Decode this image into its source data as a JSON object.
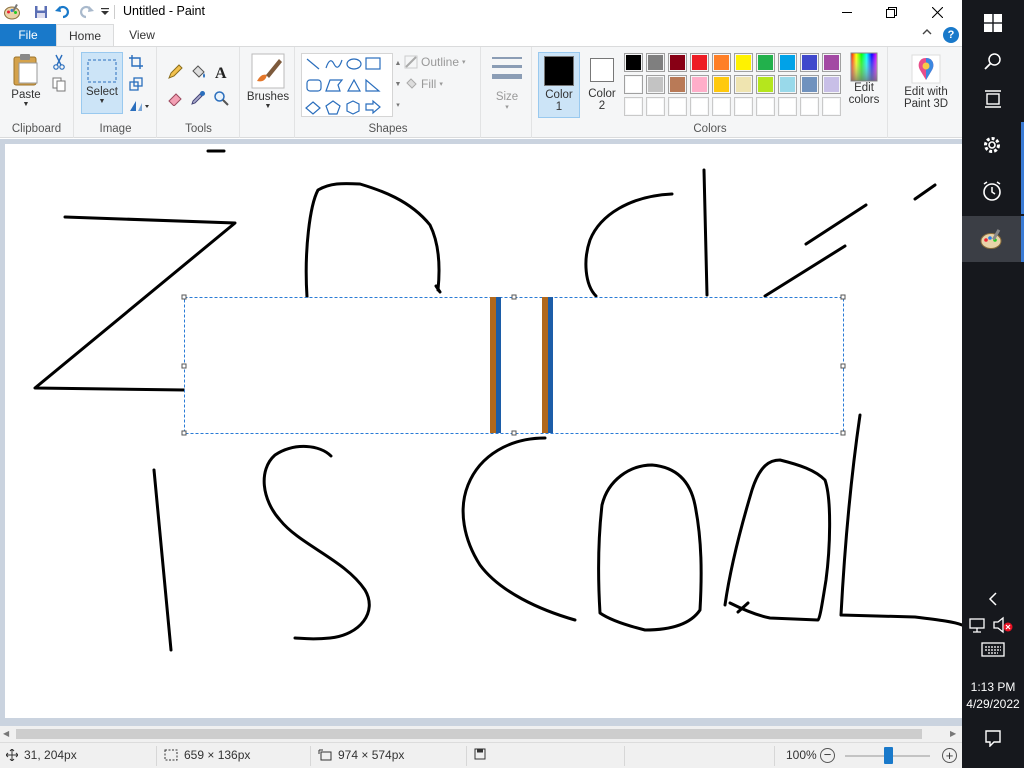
{
  "window": {
    "title": "Untitled - Paint"
  },
  "quick_access": {
    "icons": [
      "paint-app-icon",
      "save-icon",
      "undo-icon",
      "redo-icon",
      "customize-dropdown-icon"
    ]
  },
  "menu": {
    "file": "File",
    "home": "Home",
    "view": "View",
    "help": "?"
  },
  "ribbon": {
    "clipboard": {
      "label": "Clipboard",
      "paste": "Paste"
    },
    "image": {
      "label": "Image",
      "select": "Select"
    },
    "tools": {
      "label": "Tools"
    },
    "brushes": {
      "label": "Brushes"
    },
    "shapes": {
      "label": "Shapes",
      "outline": "Outline",
      "fill": "Fill"
    },
    "size": {
      "label": "Size"
    },
    "colors": {
      "label": "Colors",
      "color1": "Color 1",
      "color2": "Color 2",
      "color1_value": "#000000",
      "color2_value": "#ffffff",
      "edit_colors": "Edit colors",
      "palette_row1": [
        "#000000",
        "#7f7f7f",
        "#880015",
        "#ed1c24",
        "#ff7f27",
        "#fff200",
        "#22b14c",
        "#00a2e8",
        "#3f48cc",
        "#a349a4"
      ],
      "palette_row2": [
        "#ffffff",
        "#c3c3c3",
        "#b97a57",
        "#ffaec9",
        "#ffc90e",
        "#efe4b0",
        "#b5e61d",
        "#99d9ea",
        "#7092be",
        "#c8bfe7"
      ],
      "palette_row3": [
        "#ffffff",
        "#ffffff",
        "#ffffff",
        "#ffffff",
        "#ffffff",
        "#ffffff",
        "#ffffff",
        "#ffffff",
        "#ffffff",
        "#ffffff"
      ]
    },
    "paint3d": {
      "label": "Edit with Paint 3D"
    }
  },
  "status": {
    "cursor_pos": "31, 204px",
    "selection_size": "659 × 136px",
    "canvas_size": "974 × 574px",
    "zoom": "100%"
  },
  "taskbar": {
    "time": "1:13 PM",
    "date": "4/29/2022",
    "icons": [
      "windows-start-icon",
      "search-icon",
      "task-view-icon",
      "settings-icon",
      "alarms-clock-icon",
      "paint-app-icon"
    ],
    "tray_icons": [
      "show-hidden-chevron-icon",
      "network-icon",
      "volume-muted-icon",
      "keyboard-icon",
      "notifications-icon"
    ]
  },
  "accent": "#1979ca",
  "taskbar_bg": "#16181d"
}
